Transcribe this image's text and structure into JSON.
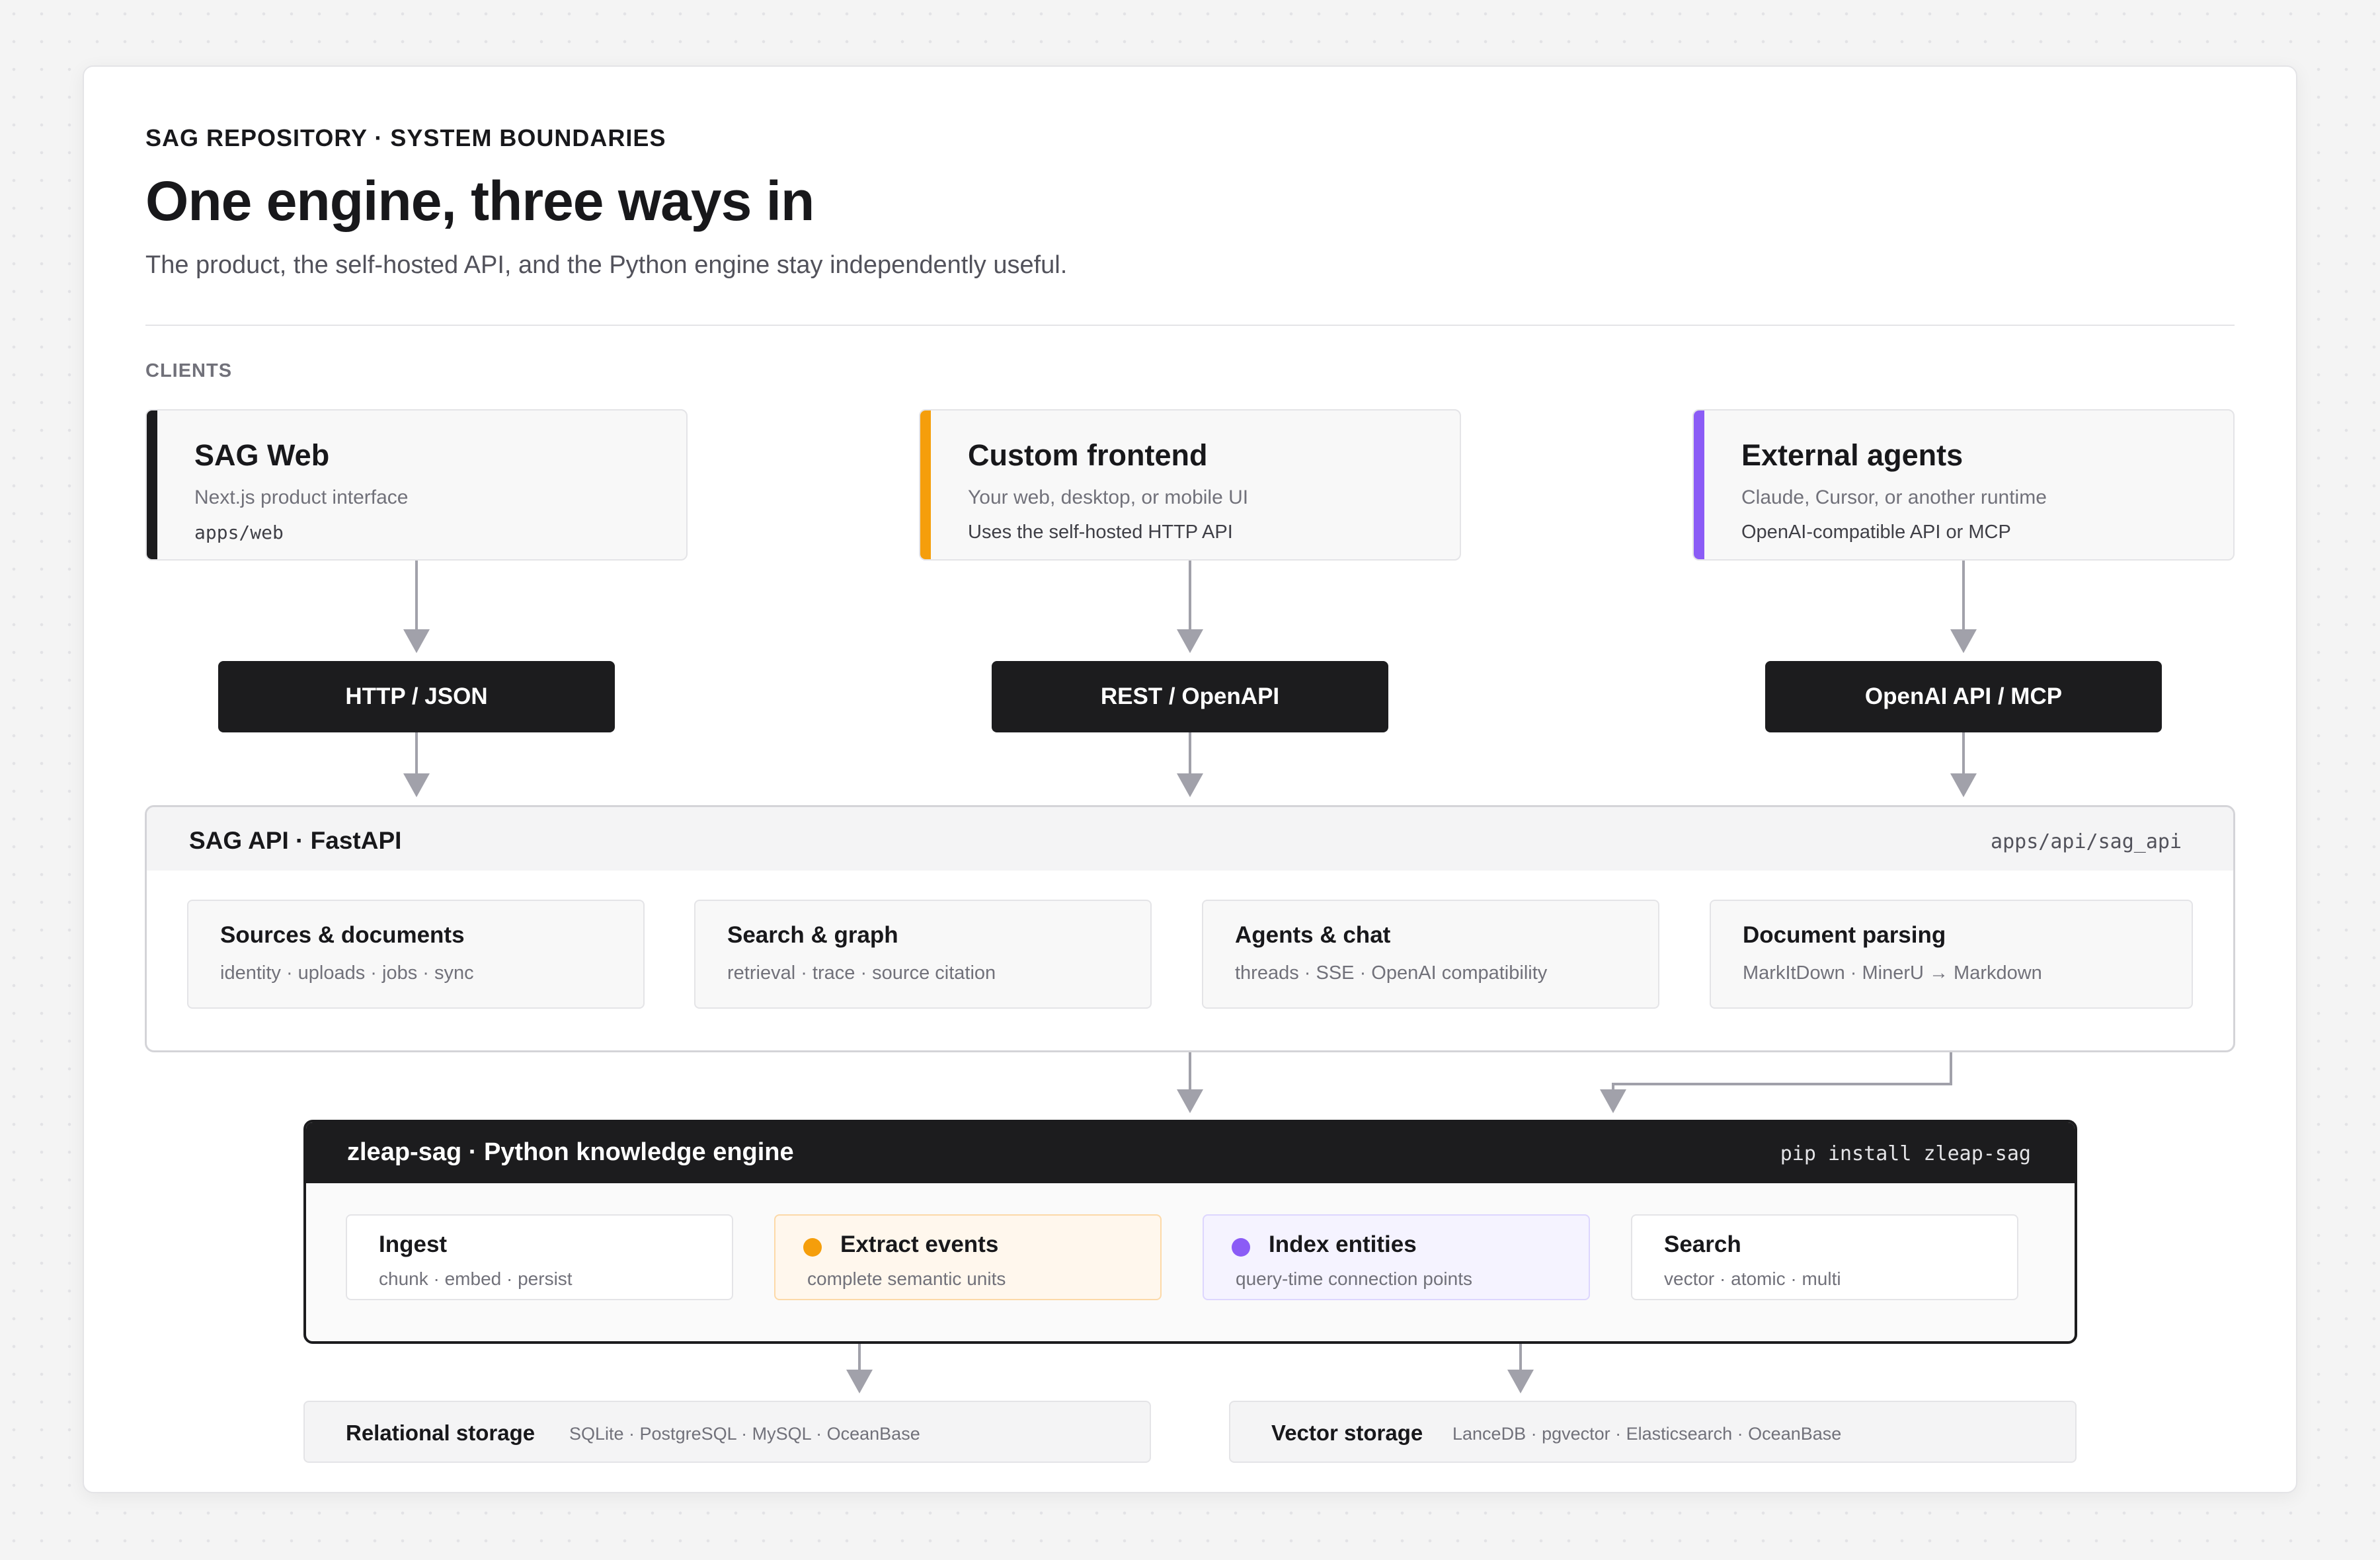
{
  "header": {
    "eyebrow": "SAG REPOSITORY · SYSTEM BOUNDARIES",
    "title": "One engine, three ways in",
    "subtitle": "The product, the self-hosted API, and the Python engine stay independently useful."
  },
  "clients_label": "CLIENTS",
  "clients": [
    {
      "title": "SAG Web",
      "subtitle": "Next.js product interface",
      "meta": "apps/web",
      "accent": "#1c1c1e",
      "protocol": "HTTP / JSON"
    },
    {
      "title": "Custom frontend",
      "subtitle": "Your web, desktop, or mobile UI",
      "meta": "Uses the self-hosted HTTP API",
      "accent": "#f59e0b",
      "protocol": "REST / OpenAPI"
    },
    {
      "title": "External agents",
      "subtitle": "Claude, Cursor, or another runtime",
      "meta": "OpenAI-compatible API or MCP",
      "accent": "#8b5cf6",
      "protocol": "OpenAI API / MCP"
    }
  ],
  "api": {
    "title": "SAG API · FastAPI",
    "path": "apps/api/sag_api",
    "modules": [
      {
        "title": "Sources & documents",
        "subtitle": "identity · uploads · jobs · sync"
      },
      {
        "title": "Search & graph",
        "subtitle": "retrieval · trace · source citation"
      },
      {
        "title": "Agents & chat",
        "subtitle": "threads · SSE · OpenAI compatibility"
      },
      {
        "title": "Document parsing",
        "subtitle": "MarkItDown · MinerU → Markdown"
      }
    ]
  },
  "engine": {
    "title": "zleap-sag · Python knowledge engine",
    "command": "pip install zleap-sag",
    "stages": [
      {
        "title": "Ingest",
        "subtitle": "chunk · embed · persist"
      },
      {
        "title": "Extract events",
        "subtitle": "complete semantic units",
        "dot_color": "#f59e0b",
        "bg": "#fff7ed",
        "border": "#fcd9a8"
      },
      {
        "title": "Index entities",
        "subtitle": "query-time connection points",
        "dot_color": "#8b5cf6",
        "bg": "#f5f3ff",
        "border": "#ddd6fe"
      },
      {
        "title": "Search",
        "subtitle": "vector · atomic · multi"
      }
    ]
  },
  "storage": [
    {
      "title": "Relational storage",
      "backends": "SQLite · PostgreSQL · MySQL · OceanBase"
    },
    {
      "title": "Vector storage",
      "backends": "LanceDB · pgvector · Elasticsearch · OceanBase"
    }
  ],
  "colors": {
    "ink": "#18181b",
    "muted": "#71717a",
    "connector": "#a1a1aa",
    "panel_dark": "#1c1c1e",
    "accent_orange": "#f59e0b",
    "accent_purple": "#8b5cf6"
  }
}
